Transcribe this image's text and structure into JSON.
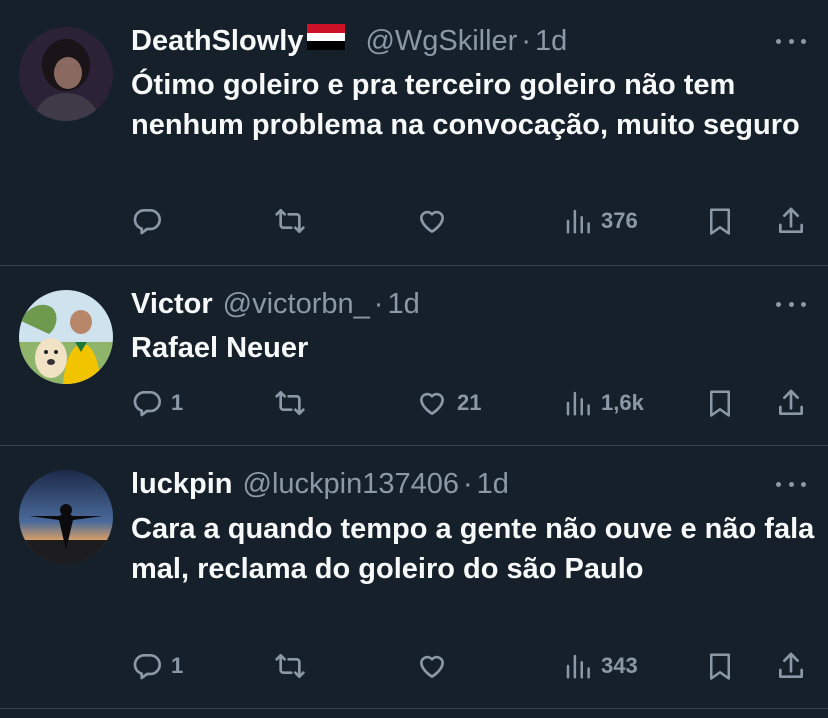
{
  "colors": {
    "background": "#15202b",
    "text": "#f7f9f9",
    "muted": "#8b98a5",
    "divider": "#38444d"
  },
  "tweets": [
    {
      "name": "DeathSlowly",
      "flag": "yemen-flag",
      "handle": "@WgSkiller",
      "dot": "·",
      "time": "1d",
      "text": "Ótimo goleiro e pra terceiro goleiro não tem nenhum problema na convocação, muito seguro",
      "replies": "",
      "retweets": "",
      "likes": "",
      "views": "376"
    },
    {
      "name": "Victor",
      "handle": "@victorbn_",
      "dot": "·",
      "time": "1d",
      "text": "Rafael Neuer",
      "replies": "1",
      "retweets": "",
      "likes": "21",
      "views": "1,6k"
    },
    {
      "name": "luckpin",
      "handle": "@luckpin137406",
      "dot": "·",
      "time": "1d",
      "text": "Cara a quando tempo a gente não ouve e não fala mal, reclama do goleiro do são Paulo",
      "replies": "1",
      "retweets": "",
      "likes": "",
      "views": "343"
    }
  ],
  "icons": {
    "reply": "reply-icon",
    "retweet": "retweet-icon",
    "like": "heart-icon",
    "views": "views-icon",
    "bookmark": "bookmark-icon",
    "share": "share-icon",
    "more": "more-icon"
  }
}
